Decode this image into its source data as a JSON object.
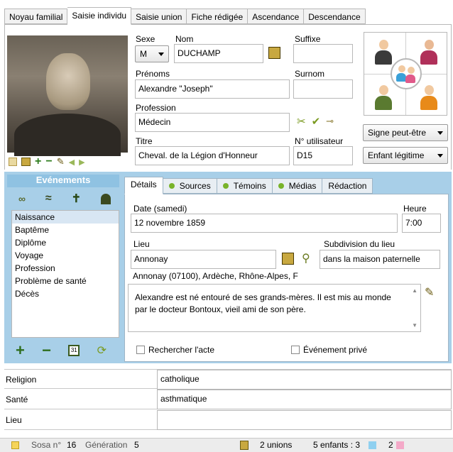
{
  "tabs": [
    "Noyau familial",
    "Saisie individu",
    "Saisie union",
    "Fiche rédigée",
    "Ascendance",
    "Descendance"
  ],
  "active_tab": "Saisie individu",
  "form": {
    "sexe_label": "Sexe",
    "sexe_value": "M",
    "nom_label": "Nom",
    "nom_value": "DUCHAMP",
    "suffixe_label": "Suffixe",
    "suffixe_value": "",
    "prenoms_label": "Prénoms",
    "prenoms_value": "Alexandre \"Joseph\"",
    "surnom_label": "Surnom",
    "surnom_value": "",
    "profession_label": "Profession",
    "profession_value": "Médecin",
    "titre_label": "Titre",
    "titre_value": "Cheval. de la Légion d'Honneur",
    "num_utilisateur_label": "N° utilisateur",
    "num_utilisateur_value": "D15",
    "signe_label": "Signe peut-être",
    "filiation_label": "Enfant légitime"
  },
  "events": {
    "header": "Evénements",
    "items": [
      "Naissance",
      "Baptême",
      "Diplôme",
      "Voyage",
      "Profession",
      "Problème de santé",
      "Décès"
    ],
    "selected": "Naissance"
  },
  "detail_tabs": [
    "Détails",
    "Sources",
    "Témoins",
    "Médias",
    "Rédaction"
  ],
  "details": {
    "date_label": "Date (samedi)",
    "date_value": "12 novembre 1859",
    "heure_label": "Heure",
    "heure_value": "7:00",
    "lieu_label": "Lieu",
    "lieu_value": "Annonay",
    "subdivision_label": "Subdivision du lieu",
    "subdivision_value": "dans la maison paternelle",
    "lieu_full": "Annonay (07100), Ardèche, Rhône-Alpes, F",
    "note": "Alexandre est né entouré de ses grands-mères. Il est mis au monde par le docteur Bontoux, vieil ami de son père.",
    "rechercher_label": "Rechercher l'acte",
    "prive_label": "Événement privé"
  },
  "extra_rows": [
    {
      "label": "Religion",
      "value": "catholique"
    },
    {
      "label": "Santé",
      "value": "asthmatique"
    },
    {
      "label": "Lieu",
      "value": ""
    }
  ],
  "status": {
    "sosa_label": "Sosa n°",
    "sosa_value": "16",
    "generation_label": "Génération",
    "generation_value": "5",
    "unions": "2 unions",
    "enfants": "5 enfants : 3",
    "filles": "2"
  },
  "colors": {
    "event_panel": "#a8cfe8",
    "green_dot": "#78b32a",
    "boy_swatch": "#8fd0f0",
    "girl_swatch": "#f4a9c8"
  }
}
